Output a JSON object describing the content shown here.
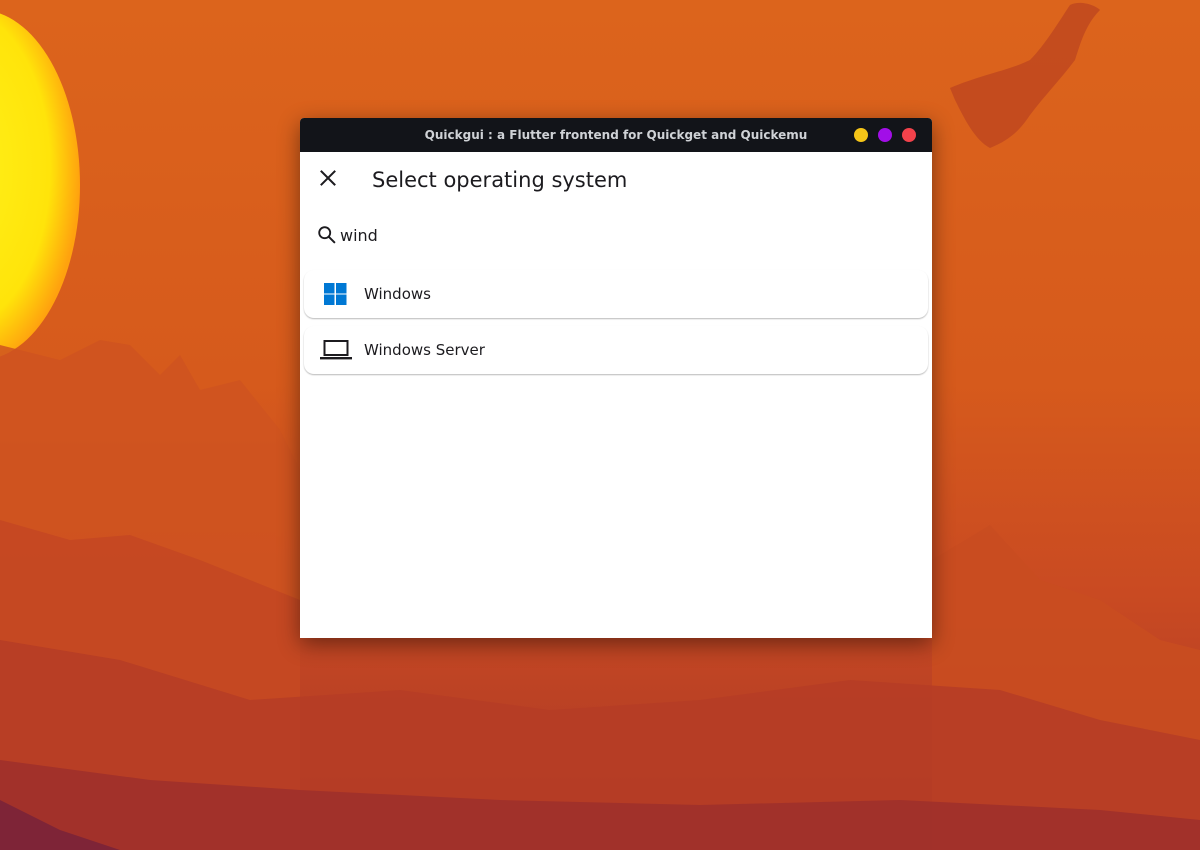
{
  "window": {
    "title": "Quickgui : a Flutter frontend for Quickget and Quickemu",
    "controls": {
      "minimize_color": "#f5c518",
      "maximize_color": "#a20ee8",
      "close_color": "#f2424b"
    }
  },
  "page": {
    "title": "Select operating system",
    "close_icon": "close-icon"
  },
  "search": {
    "value": "wind",
    "icon": "search-icon"
  },
  "os_list": [
    {
      "label": "Windows",
      "icon": "windows-logo-icon",
      "icon_color": "#0078d4"
    },
    {
      "label": "Windows Server",
      "icon": "laptop-icon"
    }
  ],
  "colors": {
    "titlebar": "#121419",
    "cursor_accent": "#c2185b",
    "wallpaper": "#dc641c"
  }
}
